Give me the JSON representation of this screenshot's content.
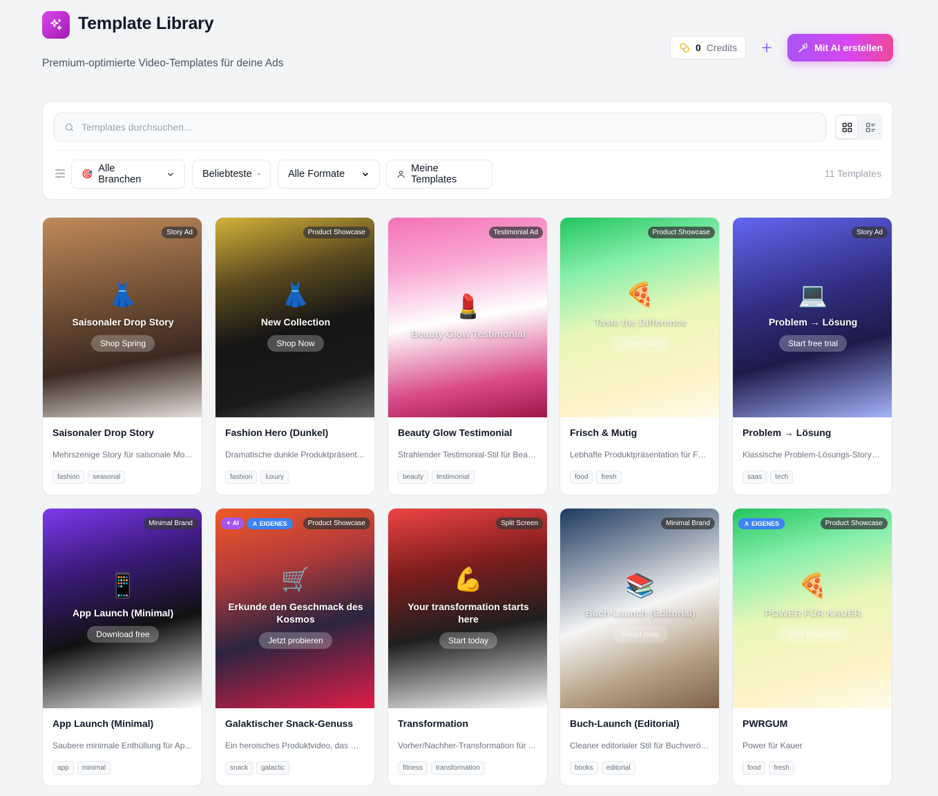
{
  "header": {
    "title": "Template Library",
    "subtitle": "Premium-optimierte Video-Templates für deine Ads",
    "credits_value": "0",
    "credits_label": "Credits",
    "ai_button_label": "Mit AI erstellen"
  },
  "search": {
    "placeholder": "Templates durchsuchen..."
  },
  "filters": {
    "industry": "Alle Branchen",
    "sort": "Beliebteste",
    "format": "Alle Formate",
    "mine": "Meine Templates",
    "count": "11 Templates"
  },
  "cards": [
    {
      "type": "Story Ad",
      "icon": "👗",
      "thumb_title": "Saisonaler Drop Story",
      "cta": "Shop Spring",
      "title": "Saisonaler Drop Story",
      "desc": "Mehrszenige Story für saisonale Mo...",
      "tags": [
        "fashion",
        "seasonal"
      ],
      "gradient": "linear-gradient(170deg,#c08a5a 0%,#6b4a32 45%,#3c2a22 70%,#e5dfd8 100%)",
      "faded": false
    },
    {
      "type": "Product Showcase",
      "icon": "👗",
      "thumb_title": "New Collection",
      "cta": "Shop Now",
      "title": "Fashion Hero (Dunkel)",
      "desc": "Dramatische dunkle Produktpräsent...",
      "tags": [
        "fashion",
        "luxury"
      ],
      "gradient": "linear-gradient(165deg,#d4b23a 0%,#5a4a1e 30%,#151515 55%,#1a1a1a 80%,#6a6a6a 100%)",
      "faded": false
    },
    {
      "type": "Testimonial Ad",
      "icon": "💄",
      "thumb_title": "Beauty Glow Testimonial",
      "cta": "",
      "title": "Beauty Glow Testimonial",
      "desc": "Strahlender Testimonial-Stil für Beau...",
      "tags": [
        "beauty",
        "testimonial"
      ],
      "gradient": "linear-gradient(170deg,#f472b6 0%,#f9a8d4 25%,#ffffff 50%,#d94b8a 80%,#9d1747 100%)",
      "faded": true
    },
    {
      "type": "Product Showcase",
      "icon": "🍕",
      "thumb_title": "Taste the Difference",
      "cta": "Order Now",
      "title": "Frisch & Mutig",
      "desc": "Lebhafte Produktpräsentation für Fo...",
      "tags": [
        "food",
        "fresh"
      ],
      "gradient": "linear-gradient(165deg,#22c55e 0%,#86efac 25%,#e9f7b8 50%,#fef3c7 80%,#fffbea 100%)",
      "faded": true
    },
    {
      "type": "Story Ad",
      "icon": "💻",
      "thumb_title": "Problem → Lösung",
      "cta": "Start free trial",
      "title": "Problem → Lösung",
      "desc": "Klassische Problem-Lösungs-Story f...",
      "tags": [
        "saas",
        "tech"
      ],
      "gradient": "linear-gradient(165deg,#6366f1 0%,#312e81 40%,#1e1b4b 65%,#a5b4fc 100%)",
      "faded": false
    },
    {
      "type": "Minimal Brand",
      "icon": "📱",
      "thumb_title": "App Launch (Minimal)",
      "cta": "Download free",
      "title": "App Launch (Minimal)",
      "desc": "Saubere minimale Enthüllung für Ap...",
      "tags": [
        "app",
        "minimal"
      ],
      "gradient": "linear-gradient(165deg,#7c3aed 0%,#3b1a7a 30%,#111111 60%,#ffffff 100%)",
      "faded": false,
      "ai": false,
      "own": false
    },
    {
      "type": "Product Showcase",
      "icon": "🛒",
      "thumb_title": "Erkunde den Geschmack des Kosmos",
      "cta": "Jetzt probieren",
      "title": "Galaktischer Snack-Genuss",
      "desc": "Ein heroisches Produktvideo, das Co...",
      "tags": [
        "snack",
        "galactic"
      ],
      "gradient": "linear-gradient(165deg,#f05a28 0%,#b33a3a 30%,#2b2540 60%,#e11d48 100%)",
      "faded": false,
      "ai": true,
      "own": true
    },
    {
      "type": "Split Screen",
      "icon": "💪",
      "thumb_title": "Your transformation starts here",
      "cta": "Start today",
      "title": "Transformation",
      "desc": "Vorher/Nachher-Transformation für ...",
      "tags": [
        "fitness",
        "transformation"
      ],
      "gradient": "linear-gradient(170deg,#ef4444 0%,#7f1d1d 30%,#1f1f1f 60%,#ffffff 100%)",
      "faded": false
    },
    {
      "type": "Minimal Brand",
      "icon": "📚",
      "thumb_title": "Buch-Launch (Editorial)",
      "cta": "Read now",
      "title": "Buch-Launch (Editorial)",
      "desc": "Cleaner editorialer Stil für Buchveröf...",
      "tags": [
        "books",
        "editorial"
      ],
      "gradient": "linear-gradient(160deg,#1e3a5f 0%,#9aa5b4 30%,#f5f5f5 50%,#b8a48a 75%,#7a6248 100%)",
      "faded": true
    },
    {
      "type": "Product Showcase",
      "icon": "🍕",
      "thumb_title": "POWER FÜR KAUER",
      "cta": "Jetzt bestellen",
      "title": "PWRGUM",
      "desc": "Power für Kauer",
      "tags": [
        "food",
        "fresh"
      ],
      "gradient": "linear-gradient(165deg,#22c55e 0%,#86efac 25%,#e9f7b8 50%,#fef3c7 80%,#fffbea 100%)",
      "faded": true,
      "own": true
    }
  ],
  "own_badge_label": "EIGENES",
  "ai_badge_label": "AI"
}
